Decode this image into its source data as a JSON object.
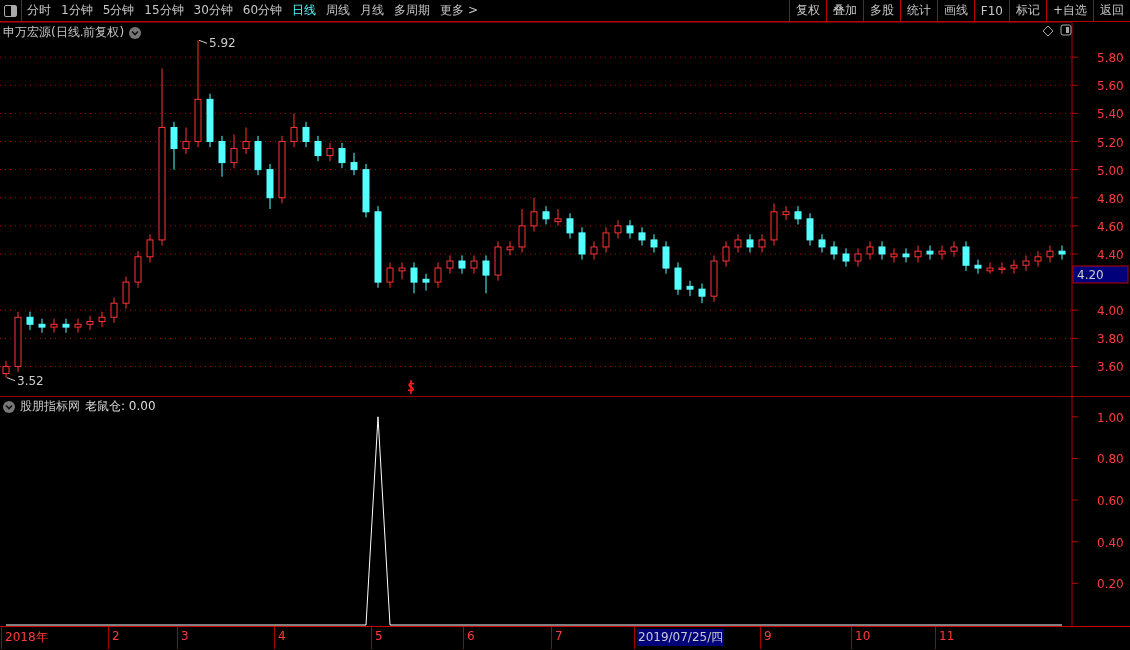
{
  "toolbar": {
    "periods": [
      {
        "label": "分时",
        "selected": false
      },
      {
        "label": "1分钟",
        "selected": false
      },
      {
        "label": "5分钟",
        "selected": false
      },
      {
        "label": "15分钟",
        "selected": false
      },
      {
        "label": "30分钟",
        "selected": false
      },
      {
        "label": "60分钟",
        "selected": false
      },
      {
        "label": "日线",
        "selected": true
      },
      {
        "label": "周线",
        "selected": false
      },
      {
        "label": "月线",
        "selected": false
      },
      {
        "label": "多周期",
        "selected": false
      },
      {
        "label": "更多 >",
        "selected": false
      }
    ],
    "actions": [
      "复权",
      "叠加",
      "多股",
      "统计",
      "画线",
      "F10",
      "标记",
      "+自选",
      "返回"
    ]
  },
  "price_panel": {
    "title": "申万宏源(日线.前复权)",
    "price_marker": "4.20",
    "chart_data": {
      "type": "candlestick",
      "grid": true,
      "ylim": [
        3.39,
        6.05
      ],
      "yticks": [
        {
          "value": 5.8,
          "label": "5.80"
        },
        {
          "value": 5.6,
          "label": "5.60"
        },
        {
          "value": 5.4,
          "label": "5.40"
        },
        {
          "value": 5.2,
          "label": "5.20"
        },
        {
          "value": 5.0,
          "label": "5.00"
        },
        {
          "value": 4.8,
          "label": "4.80"
        },
        {
          "value": 4.6,
          "label": "4.60"
        },
        {
          "value": 4.4,
          "label": "4.40"
        },
        {
          "value": 4.0,
          "label": "4.00"
        },
        {
          "value": 3.8,
          "label": "3.80"
        },
        {
          "value": 3.6,
          "label": "3.60"
        }
      ],
      "ohlc": [
        [
          3.55,
          3.64,
          3.52,
          3.6
        ],
        [
          3.6,
          3.99,
          3.56,
          3.95
        ],
        [
          3.95,
          3.99,
          3.86,
          3.9
        ],
        [
          3.9,
          3.94,
          3.84,
          3.88
        ],
        [
          3.88,
          3.94,
          3.84,
          3.9
        ],
        [
          3.9,
          3.94,
          3.84,
          3.88
        ],
        [
          3.88,
          3.94,
          3.84,
          3.9
        ],
        [
          3.9,
          3.96,
          3.86,
          3.92
        ],
        [
          3.92,
          3.99,
          3.88,
          3.95
        ],
        [
          3.95,
          4.09,
          3.91,
          4.05
        ],
        [
          4.05,
          4.24,
          4.01,
          4.2
        ],
        [
          4.2,
          4.42,
          4.16,
          4.38
        ],
        [
          4.38,
          4.54,
          4.34,
          4.5
        ],
        [
          4.5,
          5.72,
          4.46,
          5.3
        ],
        [
          5.3,
          5.34,
          5.0,
          5.15
        ],
        [
          5.15,
          5.3,
          5.11,
          5.2
        ],
        [
          5.2,
          5.92,
          5.16,
          5.5
        ],
        [
          5.5,
          5.54,
          5.16,
          5.2
        ],
        [
          5.2,
          5.24,
          4.95,
          5.05
        ],
        [
          5.05,
          5.25,
          5.01,
          5.15
        ],
        [
          5.15,
          5.3,
          5.11,
          5.2
        ],
        [
          5.2,
          5.24,
          4.96,
          5.0
        ],
        [
          5.0,
          5.04,
          4.72,
          4.8
        ],
        [
          4.8,
          5.24,
          4.76,
          5.2
        ],
        [
          5.2,
          5.4,
          5.16,
          5.3
        ],
        [
          5.3,
          5.34,
          5.16,
          5.2
        ],
        [
          5.2,
          5.24,
          5.06,
          5.1
        ],
        [
          5.1,
          5.19,
          5.06,
          5.15
        ],
        [
          5.15,
          5.19,
          5.01,
          5.05
        ],
        [
          5.05,
          5.12,
          4.96,
          5.0
        ],
        [
          5.0,
          5.04,
          4.66,
          4.7
        ],
        [
          4.7,
          4.74,
          4.16,
          4.2
        ],
        [
          4.2,
          4.34,
          4.16,
          4.3
        ],
        [
          4.28,
          4.34,
          4.22,
          4.3
        ],
        [
          4.3,
          4.34,
          4.12,
          4.2
        ],
        [
          4.22,
          4.26,
          4.14,
          4.2
        ],
        [
          4.2,
          4.34,
          4.16,
          4.3
        ],
        [
          4.3,
          4.39,
          4.26,
          4.35
        ],
        [
          4.35,
          4.39,
          4.26,
          4.3
        ],
        [
          4.3,
          4.39,
          4.26,
          4.35
        ],
        [
          4.35,
          4.39,
          4.12,
          4.25
        ],
        [
          4.25,
          4.49,
          4.21,
          4.45
        ],
        [
          4.43,
          4.49,
          4.39,
          4.45
        ],
        [
          4.45,
          4.72,
          4.41,
          4.6
        ],
        [
          4.6,
          4.8,
          4.56,
          4.7
        ],
        [
          4.7,
          4.74,
          4.61,
          4.65
        ],
        [
          4.63,
          4.72,
          4.6,
          4.65
        ],
        [
          4.65,
          4.69,
          4.51,
          4.55
        ],
        [
          4.55,
          4.59,
          4.36,
          4.4
        ],
        [
          4.4,
          4.49,
          4.36,
          4.45
        ],
        [
          4.45,
          4.59,
          4.41,
          4.55
        ],
        [
          4.55,
          4.64,
          4.51,
          4.6
        ],
        [
          4.6,
          4.64,
          4.51,
          4.55
        ],
        [
          4.55,
          4.59,
          4.46,
          4.5
        ],
        [
          4.5,
          4.54,
          4.41,
          4.45
        ],
        [
          4.45,
          4.49,
          4.26,
          4.3
        ],
        [
          4.3,
          4.34,
          4.11,
          4.15
        ],
        [
          4.17,
          4.21,
          4.1,
          4.15
        ],
        [
          4.15,
          4.19,
          4.05,
          4.1
        ],
        [
          4.1,
          4.39,
          4.06,
          4.35
        ],
        [
          4.35,
          4.49,
          4.31,
          4.45
        ],
        [
          4.45,
          4.54,
          4.41,
          4.5
        ],
        [
          4.5,
          4.54,
          4.41,
          4.45
        ],
        [
          4.45,
          4.54,
          4.41,
          4.5
        ],
        [
          4.5,
          4.76,
          4.46,
          4.7
        ],
        [
          4.68,
          4.74,
          4.64,
          4.7
        ],
        [
          4.7,
          4.74,
          4.61,
          4.65
        ],
        [
          4.65,
          4.69,
          4.46,
          4.5
        ],
        [
          4.5,
          4.54,
          4.41,
          4.45
        ],
        [
          4.45,
          4.49,
          4.36,
          4.4
        ],
        [
          4.4,
          4.44,
          4.31,
          4.35
        ],
        [
          4.35,
          4.44,
          4.31,
          4.4
        ],
        [
          4.4,
          4.49,
          4.36,
          4.45
        ],
        [
          4.45,
          4.49,
          4.36,
          4.4
        ],
        [
          4.38,
          4.44,
          4.34,
          4.4
        ],
        [
          4.4,
          4.44,
          4.34,
          4.38
        ],
        [
          4.38,
          4.46,
          4.34,
          4.42
        ],
        [
          4.42,
          4.46,
          4.36,
          4.4
        ],
        [
          4.4,
          4.46,
          4.36,
          4.42
        ],
        [
          4.42,
          4.49,
          4.38,
          4.45
        ],
        [
          4.45,
          4.49,
          4.28,
          4.32
        ],
        [
          4.32,
          4.36,
          4.26,
          4.3
        ],
        [
          4.28,
          4.34,
          4.26,
          4.3
        ],
        [
          4.29,
          4.34,
          4.26,
          4.3
        ],
        [
          4.3,
          4.36,
          4.26,
          4.32
        ],
        [
          4.32,
          4.39,
          4.28,
          4.35
        ],
        [
          4.35,
          4.42,
          4.31,
          4.38
        ],
        [
          4.38,
          4.46,
          4.34,
          4.42
        ],
        [
          4.42,
          4.46,
          4.36,
          4.4
        ]
      ],
      "annotations": [
        "5.92",
        "3.52"
      ]
    }
  },
  "date_axis": [
    {
      "label": "2018年",
      "selected": false
    },
    {
      "label": "2",
      "selected": false
    },
    {
      "label": "3",
      "selected": false
    },
    {
      "label": "4",
      "selected": false
    },
    {
      "label": "5",
      "selected": false
    },
    {
      "label": "6",
      "selected": false
    },
    {
      "label": "7",
      "selected": false
    },
    {
      "label": "2019/07/25/四",
      "selected": true
    },
    {
      "label": "9",
      "selected": false
    },
    {
      "label": "10",
      "selected": false
    },
    {
      "label": "11",
      "selected": false
    }
  ],
  "indicator_panel": {
    "title": "股朋指标网",
    "reading": "老鼠仓: 0.00",
    "chart_data": {
      "type": "line",
      "ylim": [
        0,
        1.1
      ],
      "yticks": [
        {
          "value": 1.0,
          "label": "1.00"
        },
        {
          "value": 0.8,
          "label": "0.80"
        },
        {
          "value": 0.6,
          "label": "0.60"
        },
        {
          "value": 0.4,
          "label": "0.40"
        },
        {
          "value": 0.2,
          "label": "0.20"
        }
      ],
      "series": [
        {
          "color": "#ffffff",
          "values": [
            0,
            0,
            0,
            0,
            0,
            0,
            0,
            0,
            0,
            0,
            0,
            0,
            0,
            0,
            0,
            0,
            0,
            0,
            0,
            0,
            0,
            0,
            0,
            0,
            0,
            0,
            0,
            0,
            0,
            0,
            0,
            1,
            0,
            0,
            0,
            0,
            0,
            0,
            0,
            0,
            0,
            0,
            0,
            0,
            0,
            0,
            0,
            0,
            0,
            0,
            0,
            0,
            0,
            0,
            0,
            0,
            0,
            0,
            0,
            0,
            0,
            0,
            0,
            0,
            0,
            0,
            0,
            0,
            0,
            0,
            0,
            0,
            0,
            0,
            0,
            0,
            0,
            0,
            0,
            0,
            0,
            0,
            0,
            0,
            0,
            0,
            0,
            0,
            0
          ]
        }
      ]
    }
  }
}
